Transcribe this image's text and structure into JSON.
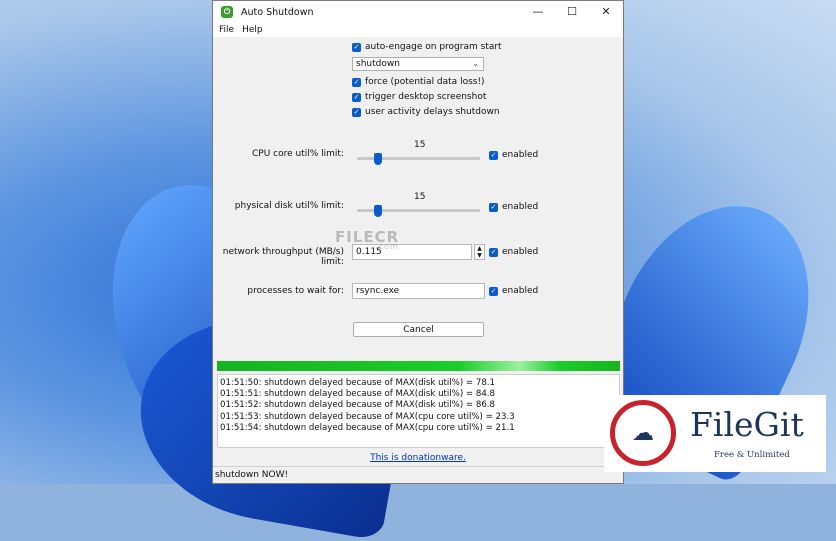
{
  "window": {
    "title": "Auto Shutdown",
    "icon": "power-icon"
  },
  "titlebar_buttons": {
    "minimize": "—",
    "maximize": "☐",
    "close": "✕"
  },
  "menu": [
    "File",
    "Help"
  ],
  "options": {
    "auto_engage": "auto-engage on program start",
    "action": "shutdown",
    "force": "force (potential data loss!)",
    "screenshot": "trigger desktop screenshot",
    "user_activity": "user activity delays shutdown"
  },
  "cpu": {
    "label": "CPU core util% limit:",
    "value": "15",
    "enabled_label": "enabled"
  },
  "disk": {
    "label": "physical disk util% limit:",
    "value": "15",
    "enabled_label": "enabled"
  },
  "network": {
    "label": "network throughput (MB/s) limit:",
    "value": "0.115",
    "enabled_label": "enabled"
  },
  "processes": {
    "label": "processes to wait for:",
    "value": "rsync.exe",
    "enabled_label": "enabled"
  },
  "cancel_label": "Cancel",
  "progress": 1.0,
  "log": [
    "01:51:50: shutdown delayed because of MAX(disk util%) = 78.1",
    "01:51:51: shutdown delayed because of MAX(disk util%) = 84.8",
    "01:51:52: shutdown delayed because of MAX(disk util%) = 86.8",
    "01:51:53: shutdown delayed because of MAX(cpu core util%) = 23.3",
    "01:51:54: shutdown delayed because of MAX(cpu core util%) = 21.1"
  ],
  "donation_link": "This is donationware.",
  "status": "shutdown NOW!",
  "watermark": {
    "text": "FILECR",
    "sub": ".com"
  },
  "filegit": {
    "name": "FileGit",
    "tagline": "Free & Unlimited"
  },
  "colors": {
    "accent": "#0b5cc9",
    "progress": "#16b321",
    "filegit_red": "#c8232c",
    "filegit_navy": "#1d3557"
  }
}
